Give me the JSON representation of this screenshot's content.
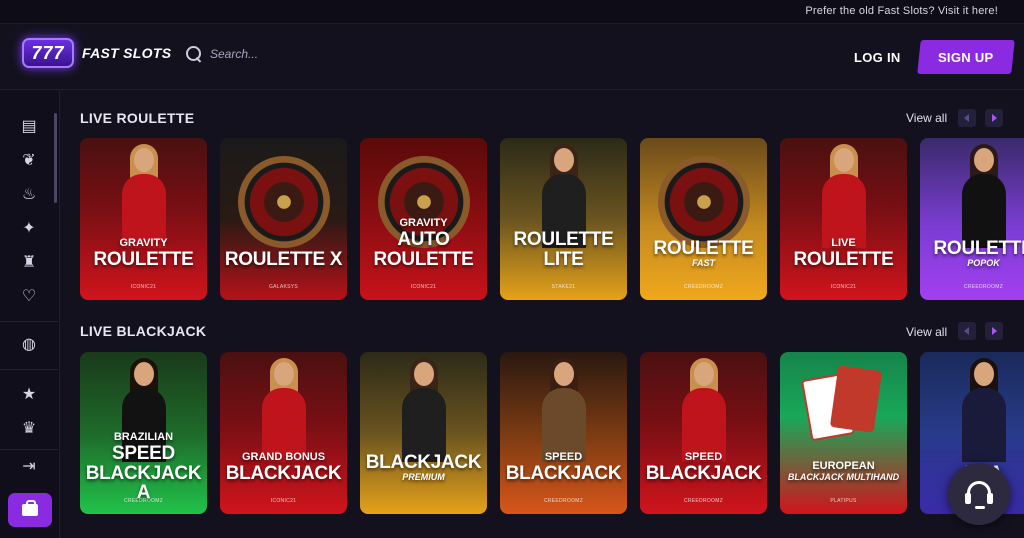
{
  "topbar": {
    "message": "Prefer the old Fast Slots? Visit it here!"
  },
  "header": {
    "logo_badge": "777",
    "logo_text": "FAST SLOTS",
    "search_placeholder": "Search...",
    "login_label": "LOG IN",
    "signup_label": "SIGN UP"
  },
  "sidebar": {
    "icons": [
      "gift-icon",
      "cherries-icon",
      "fire-icon",
      "sparkle-icon",
      "dealer-icon",
      "heart-hand-icon",
      "volleyball-icon",
      "star-icon",
      "trophy-icon",
      "collapse-arrow-icon",
      "shopping-bag-icon"
    ]
  },
  "sections": {
    "roulette": {
      "title": "LIVE ROULETTE",
      "view_all": "View all",
      "cards": [
        {
          "t1": "GRAVITY",
          "t2": "ROULETTE",
          "t3": "",
          "sub": "",
          "provider": "ICONIC21",
          "theme": "red-dealer"
        },
        {
          "t1": "",
          "t2": "ROULETTE X",
          "t3": "",
          "sub": "",
          "provider": "GALAKSYS",
          "theme": "wheel-dark"
        },
        {
          "t1": "GRAVITY",
          "t2": "AUTO",
          "t3": "ROULETTE",
          "sub": "",
          "provider": "ICONIC21",
          "theme": "wheel-red"
        },
        {
          "t1": "",
          "t2": "ROULETTE",
          "t3": "LITE",
          "sub": "",
          "provider": "STAKE21",
          "theme": "dealer-gold"
        },
        {
          "t1": "",
          "t2": "ROULETTE",
          "t3": "",
          "sub": "FAST",
          "provider": "CREEDROOMZ",
          "theme": "wheel-gold"
        },
        {
          "t1": "LIVE",
          "t2": "ROULETTE",
          "t3": "",
          "sub": "",
          "provider": "ICONIC21",
          "theme": "red-dealer"
        },
        {
          "t1": "",
          "t2": "ROULETTE",
          "t3": "",
          "sub": "POPOK",
          "provider": "CREEDROOMZ",
          "theme": "purple-dealer"
        }
      ]
    },
    "blackjack": {
      "title": "LIVE BLACKJACK",
      "view_all": "View all",
      "cards": [
        {
          "t1": "BRAZILIAN",
          "t2": "SPEED",
          "t3": "BLACKJACK A",
          "sub": "",
          "provider": "CREEDROOMZ",
          "theme": "green-dealer"
        },
        {
          "t1": "GRAND BONUS",
          "t2": "BLACKJACK",
          "t3": "",
          "sub": "",
          "provider": "ICONIC21",
          "theme": "red-dealer"
        },
        {
          "t1": "",
          "t2": "BLACKJACK",
          "t3": "",
          "sub": "PREMIUM",
          "provider": "",
          "theme": "dealer-gold"
        },
        {
          "t1": "SPEED",
          "t2": "BLACKJACK",
          "t3": "",
          "sub": "",
          "provider": "CREEDROOMZ",
          "theme": "brown-dealer"
        },
        {
          "t1": "SPEED",
          "t2": "BLACKJACK",
          "t3": "",
          "sub": "",
          "provider": "CREEDROOMZ",
          "theme": "red-dealer"
        },
        {
          "t1": "EUROPEAN",
          "t2": "",
          "t3": "",
          "sub": "BLACKJACK MULTIHAND",
          "provider": "PLATIPUS",
          "theme": "green-cards"
        },
        {
          "t1": "",
          "t2": "BLA",
          "t3": "",
          "sub": "",
          "provider": "",
          "theme": "blue-dealer"
        }
      ]
    }
  },
  "colors": {
    "accent": "#8a2be2",
    "background": "#14111f",
    "sidebar": "#110e1b"
  }
}
